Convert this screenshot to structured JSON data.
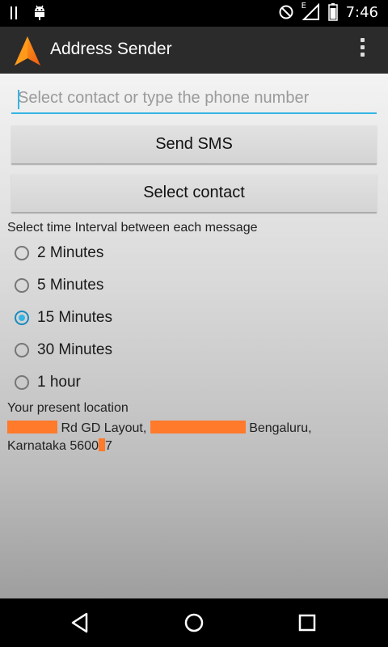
{
  "status_bar": {
    "time": "7:46",
    "network_label": "E",
    "icons": [
      "pause-icon",
      "android-debug-icon",
      "do-not-disturb-icon",
      "signal-icon",
      "battery-icon"
    ]
  },
  "app_bar": {
    "title": "Address Sender",
    "logo_icon": "navigation-arrow-icon",
    "overflow_icon": "more-vert-icon"
  },
  "form": {
    "phone_placeholder": "Select contact or type the phone number",
    "phone_value": "",
    "send_button": "Send SMS",
    "select_button": "Select contact"
  },
  "interval": {
    "label": "Select time Interval between each message",
    "options": [
      {
        "label": "2 Minutes",
        "checked": false
      },
      {
        "label": "5 Minutes",
        "checked": false
      },
      {
        "label": "15 Minutes",
        "checked": true
      },
      {
        "label": "30 Minutes",
        "checked": false
      },
      {
        "label": "1 hour",
        "checked": false
      }
    ]
  },
  "location": {
    "title": "Your present location",
    "part1": "Rd GD Layout,",
    "part2": "Bengaluru,",
    "part3": "Karnataka 5600",
    "part4": "7"
  },
  "colors": {
    "accent": "#33b5e5",
    "appbar": "#2b2b2b",
    "redaction": "#ff7a2b"
  },
  "nav_bar": {
    "icons": [
      "back-icon",
      "home-icon",
      "recents-icon"
    ]
  }
}
